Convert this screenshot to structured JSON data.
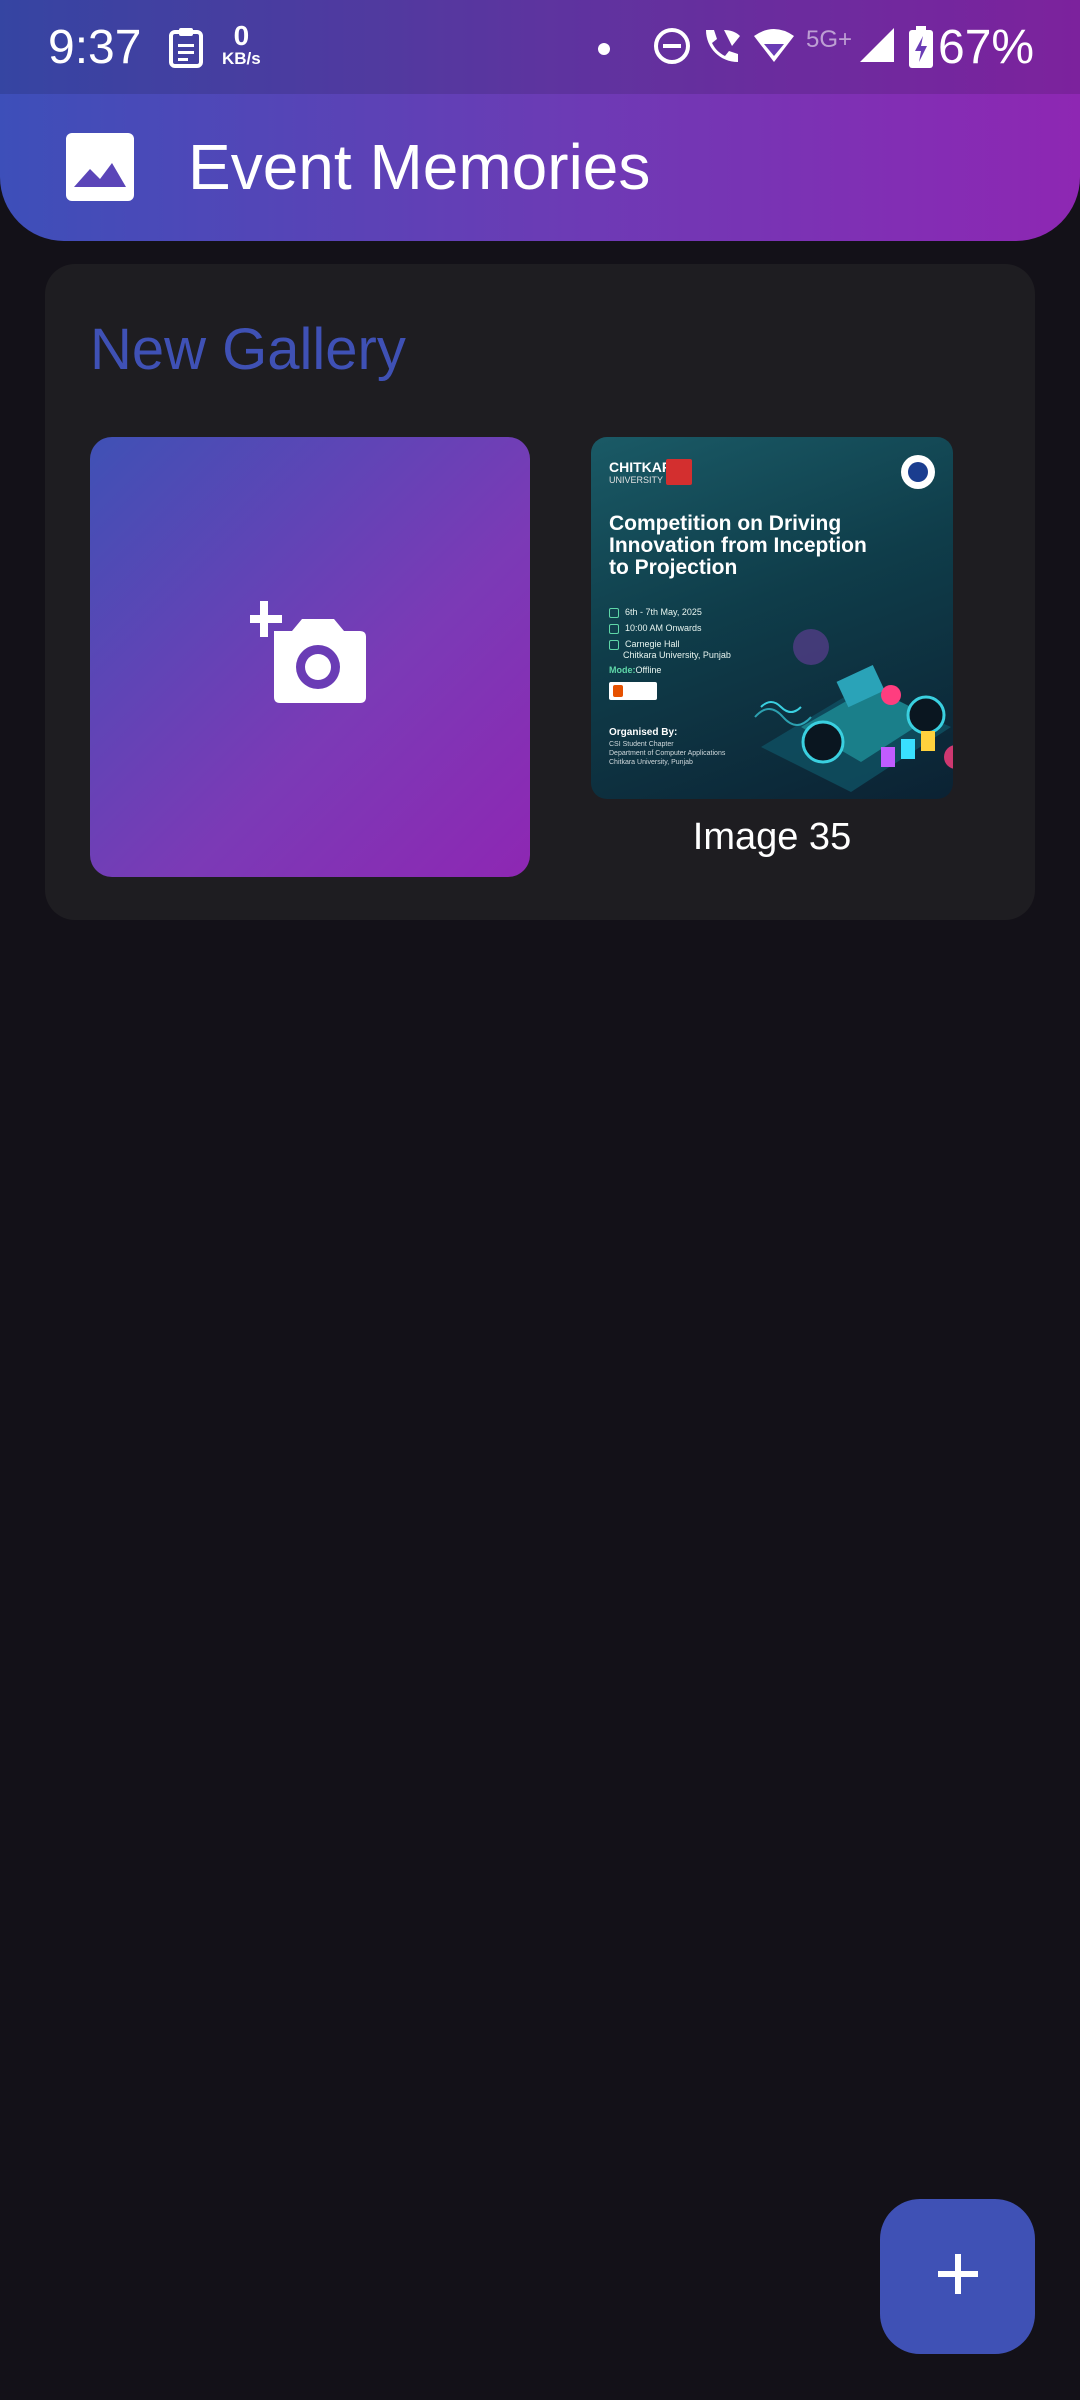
{
  "status_bar": {
    "time": "9:37",
    "net_speed_value": "0",
    "net_speed_unit": "KB/s",
    "network_type": "5G+",
    "battery": "67%"
  },
  "app_bar": {
    "title": "Event Memories",
    "icon": "image-icon"
  },
  "gallery": {
    "title": "New Gallery",
    "add_tile_icon": "add-a-photo-icon",
    "images": [
      {
        "caption": "Image 35",
        "poster": {
          "brand": "CHITKARA",
          "brand_sub": "UNIVERSITY",
          "title": "Competition on Driving Innovation from Inception to Projection",
          "date": "6th - 7th May, 2025",
          "time": "10:00 AM Onwards",
          "venue_line1": "Carnegie Hall",
          "venue_line2": "Chitkara University, Punjab",
          "mode_label": "Mode:",
          "mode_value": "Offline",
          "organised_by": "Organised By:",
          "org_line1": "CSI Student Chapter",
          "org_line2": "Department of Computer Applications",
          "org_line3": "Chitkara University, Punjab"
        }
      }
    ]
  },
  "fab": {
    "icon": "plus-icon"
  },
  "colors": {
    "accent": "#3f51b5",
    "gradient_start": "#3d4fb9",
    "gradient_end": "#8e27b3",
    "background": "#131118",
    "card": "#1e1d21"
  }
}
